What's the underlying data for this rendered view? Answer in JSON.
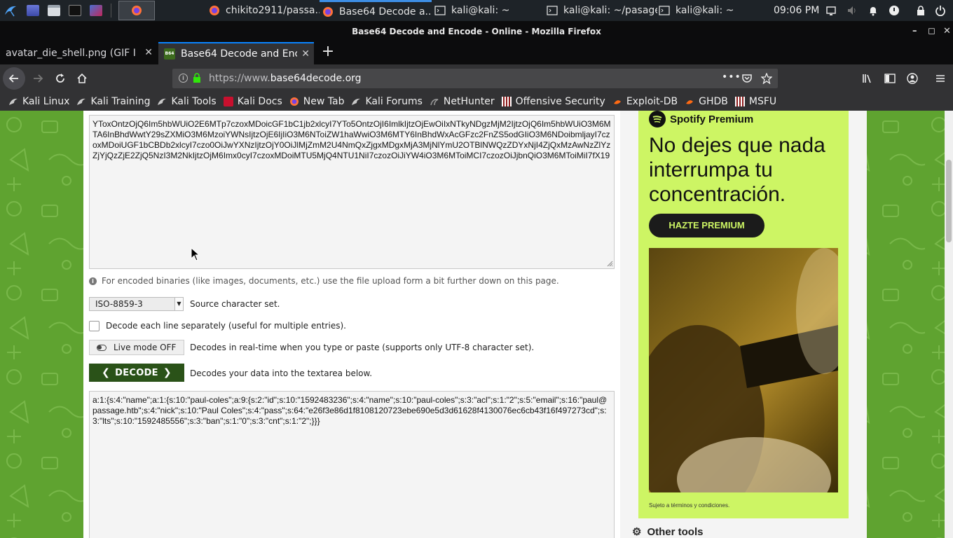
{
  "taskbar": {
    "tasks": [
      {
        "label": "chikito2911/passa...",
        "icon": "firefox-icon",
        "active": false
      },
      {
        "label": "Base64 Decode a...",
        "icon": "firefox-icon",
        "active": true
      },
      {
        "label": "kali@kali: ~",
        "icon": "terminal-icon",
        "active": false
      },
      {
        "label": "kali@kali: ~/pasage",
        "icon": "terminal-icon",
        "active": false
      },
      {
        "label": "kali@kali: ~",
        "icon": "terminal-icon",
        "active": false
      }
    ],
    "clock": "09:06 PM"
  },
  "window": {
    "title": "Base64 Decode and Encode - Online - Mozilla Firefox"
  },
  "tabs": [
    {
      "label": "avatar_die_shell.png (GIF Im",
      "selected": false
    },
    {
      "label": "Base64 Decode and Enco",
      "selected": true
    }
  ],
  "nav": {
    "url_prefix": "https://www.",
    "url_domain": "base64decode.org"
  },
  "bookmarks": [
    {
      "label": "Kali Linux",
      "icon": "kali-dragon-icon"
    },
    {
      "label": "Kali Training",
      "icon": "kali-dragon-icon"
    },
    {
      "label": "Kali Tools",
      "icon": "kali-dragon-icon"
    },
    {
      "label": "Kali Docs",
      "icon": "kali-docs-icon"
    },
    {
      "label": "New Tab",
      "icon": "firefox-icon"
    },
    {
      "label": "Kali Forums",
      "icon": "kali-dragon-icon"
    },
    {
      "label": "NetHunter",
      "icon": "nethunter-icon"
    },
    {
      "label": "Offensive Security",
      "icon": "offsec-icon"
    },
    {
      "label": "Exploit-DB",
      "icon": "exploit-db-icon"
    },
    {
      "label": "GHDB",
      "icon": "ghdb-icon"
    },
    {
      "label": "MSFU",
      "icon": "offsec-icon"
    }
  ],
  "decoder": {
    "input_text": "YToxOntzOjQ6Im5hbWUiO2E6MTp7czoxMDoicGF1bC1jb2xlcyI7YTo5OntzOjI6ImlkIjtzOjEwOiIxNTkyNDgzMjM2IjtzOjQ6Im5hbWUiO3M6MTA6InBhdWwtY29sZXMiO3M6MzoiYWNsIjtzOjE6IjIiO3M6NToiZW1haWwiO3M6MTY6InBhdWxAcGFzc2FnZS5odGIiO3M6NDoibmljayI7czoxMDoiUGF1bCBDb2xlcyI7czo0OiJwYXNzIjtzOjY0OiJlMjZmM2U4NmQxZjgxMDgxMjA3MjNlYmU2OTBlNWQzZDYxNjI4ZjQxMzAwNzZlYzZjYjQzZjE2ZjQ5NzI3M2NkIjtzOjM6Imx0cyI7czoxMDoiMTU5MjQ4NTU1NiI7czozOiJiYW4iO3M6MToiMCI7czozOiJjbnQiO3M6MToiMiI7fX19",
    "binaries_note": "For encoded binaries (like images, documents, etc.) use the file upload form a bit further down on this page.",
    "charset_value": "ISO-8859-3",
    "charset_label": "Source character set.",
    "each_line_label": "Decode each line separately (useful for multiple entries).",
    "live_mode_label": "Live mode OFF",
    "live_mode_desc": "Decodes in real-time when you type or paste (supports only UTF-8 character set).",
    "decode_label": "DECODE",
    "decode_desc": "Decodes your data into the textarea below.",
    "output_text": "a:1:{s:4:\"name\";a:1:{s:10:\"paul-coles\";a:9:{s:2:\"id\";s:10:\"1592483236\";s:4:\"name\";s:10:\"paul-coles\";s:3:\"acl\";s:1:\"2\";s:5:\"email\";s:16:\"paul@passage.htb\";s:4:\"nick\";s:10:\"Paul Coles\";s:4:\"pass\";s:64:\"e26f3e86d1f8108120723ebe690e5d3d61628f4130076ec6cb43f16f497273cd\";s:3:\"lts\";s:10:\"1592485556\";s:3:\"ban\";s:1:\"0\";s:3:\"cnt\";s:1:\"2\";}}}"
  },
  "ad": {
    "brand": "Spotify Premium",
    "headline": "No dejes que nada interrumpa tu concentración.",
    "cta": "HAZTE PREMIUM",
    "legal": "Sujeto a términos y condiciones.",
    "colors": {
      "background": "#cdf564",
      "button": "#1b1b1b"
    }
  },
  "sidebar": {
    "other_tools": "Other tools"
  },
  "colors": {
    "page_green": "#5fa330",
    "decode_button": "#2a5218",
    "tab_accent": "#0a84ff"
  }
}
